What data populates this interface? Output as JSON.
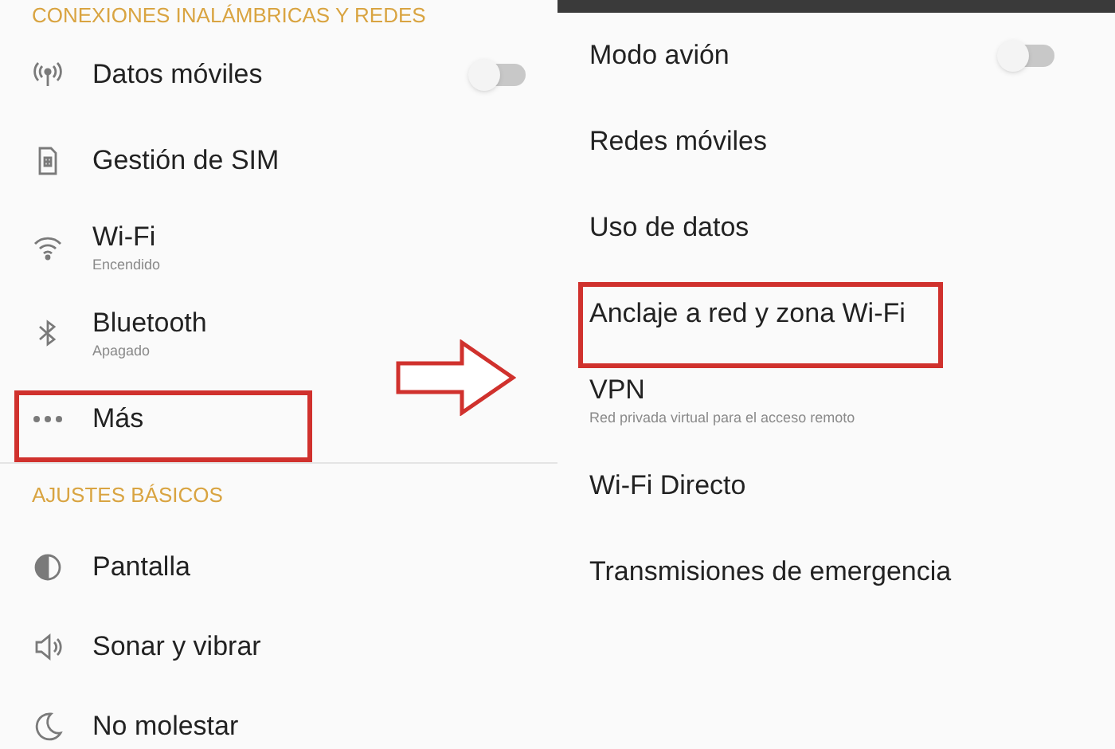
{
  "left_screen": {
    "sections": [
      {
        "header": "CONEXIONES INALÁMBRICAS Y REDES",
        "items": [
          {
            "title": "Datos móviles",
            "toggle": {
              "on": false
            },
            "highlighted": false
          },
          {
            "title": "Gestión de SIM",
            "highlighted": false
          },
          {
            "title": "Wi-Fi",
            "subtitle": "Encendido",
            "highlighted": false
          },
          {
            "title": "Bluetooth",
            "subtitle": "Apagado",
            "highlighted": false
          },
          {
            "title": "Más",
            "highlighted": true
          }
        ]
      },
      {
        "header": "AJUSTES BÁSICOS",
        "items": [
          {
            "title": "Pantalla",
            "highlighted": false
          },
          {
            "title": "Sonar y vibrar",
            "highlighted": false
          },
          {
            "title": "No molestar",
            "highlighted": false
          }
        ]
      }
    ]
  },
  "right_screen": {
    "items": [
      {
        "title": "Modo avión",
        "toggle": {
          "on": false
        },
        "highlighted": false
      },
      {
        "title": "Redes móviles",
        "highlighted": false
      },
      {
        "title": "Uso de datos",
        "highlighted": false
      },
      {
        "title": "Anclaje a red y zona Wi-Fi",
        "highlighted": true
      },
      {
        "title": "VPN",
        "subtitle": "Red privada virtual para el acceso remoto",
        "highlighted": false
      },
      {
        "title": "Wi-Fi Directo",
        "highlighted": false
      },
      {
        "title": "Transmisiones de emergencia",
        "highlighted": false
      }
    ]
  }
}
